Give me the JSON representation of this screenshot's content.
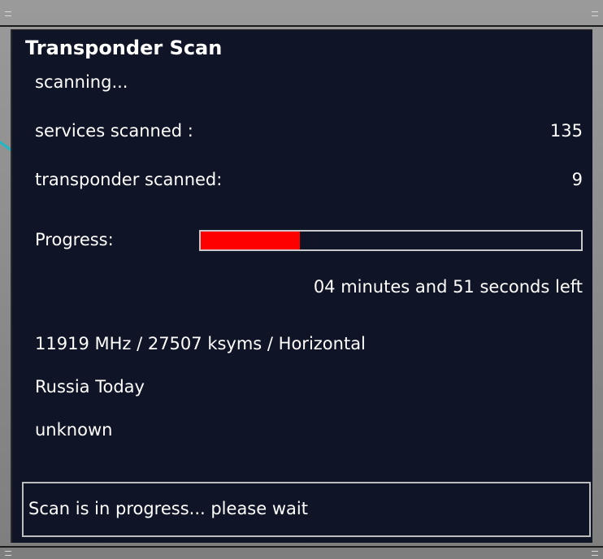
{
  "dialog": {
    "title": "Transponder Scan",
    "state": "scanning..."
  },
  "stats": {
    "services_label": "services scanned    :",
    "services_value": "135",
    "transponder_label": "transponder scanned:",
    "transponder_value": "9"
  },
  "progress": {
    "label": "Progress:",
    "fraction": 0.26,
    "time_left": "04 minutes and 51 seconds left"
  },
  "current": {
    "frequency": "11919 MHz / 27507 ksyms / Horizontal",
    "service": "Russia Today",
    "provider": "unknown"
  },
  "status": {
    "message": "Scan is in progress... please wait"
  },
  "colors": {
    "background": "#0f1426",
    "progress_fill": "#ff0000",
    "text": "#ffffff"
  }
}
